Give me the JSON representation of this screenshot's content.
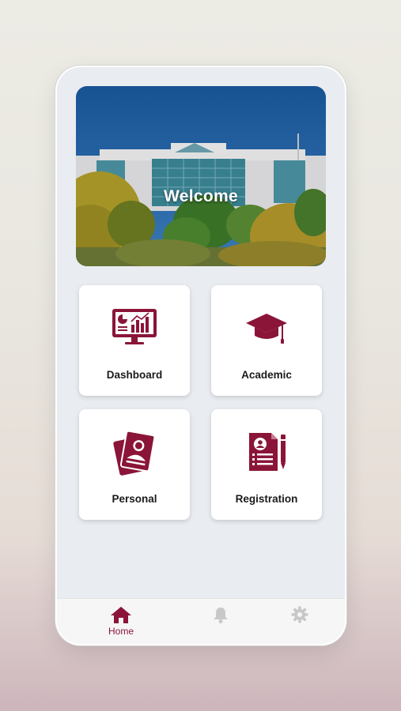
{
  "banner": {
    "title": "Welcome"
  },
  "tiles": [
    {
      "label": "Dashboard",
      "icon": "monitor-chart-icon"
    },
    {
      "label": "Academic",
      "icon": "graduation-cap-icon"
    },
    {
      "label": "Personal",
      "icon": "id-card-icon"
    },
    {
      "label": "Registration",
      "icon": "registration-form-icon"
    }
  ],
  "nav": {
    "items": [
      {
        "label": "Home",
        "icon": "home-icon",
        "active": true
      },
      {
        "label": "",
        "icon": "bell-icon",
        "active": false
      },
      {
        "label": "",
        "icon": "gear-icon",
        "active": false
      }
    ]
  },
  "colors": {
    "accent": "#8a1538",
    "inactive": "#c8c8c8",
    "background": "#e9ecf0"
  }
}
